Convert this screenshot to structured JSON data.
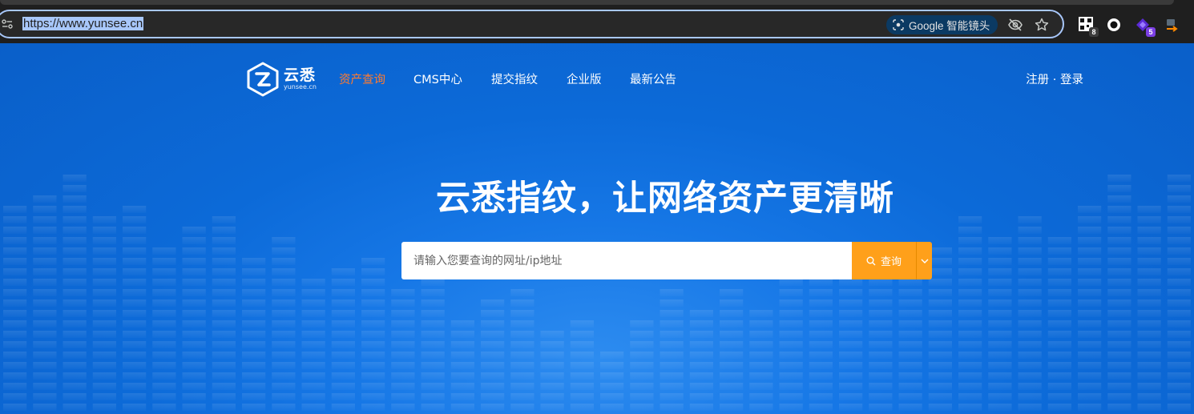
{
  "browser": {
    "url": "https://www.yunsee.cn",
    "lens_label": "Google 智能镜头",
    "extensions": [
      {
        "icon": "qr-extension-icon",
        "badge": "8"
      },
      {
        "icon": "circle-extension-icon",
        "badge": ""
      },
      {
        "icon": "purple-extension-icon",
        "badge": "5"
      },
      {
        "icon": "arrow-extension-icon",
        "badge": ""
      }
    ]
  },
  "site": {
    "logo_cn": "云悉",
    "logo_en": "yunsee.cn",
    "nav": [
      {
        "label": "资产查询",
        "active": true
      },
      {
        "label": "CMS中心",
        "active": false
      },
      {
        "label": "提交指纹",
        "active": false
      },
      {
        "label": "企业版",
        "active": false
      },
      {
        "label": "最新公告",
        "active": false
      }
    ],
    "auth_label": "注册 · 登录",
    "hero_title": "云悉指纹，让网络资产更清晰",
    "search": {
      "placeholder": "请输入您要查询的网址/ip地址",
      "value": "",
      "button_label": "查询"
    }
  },
  "colors": {
    "accent_orange": "#ffa01a",
    "nav_active": "#ff7a2f",
    "page_blue": "#0c6ad8",
    "omnibox_outline": "#a8c7fa"
  }
}
